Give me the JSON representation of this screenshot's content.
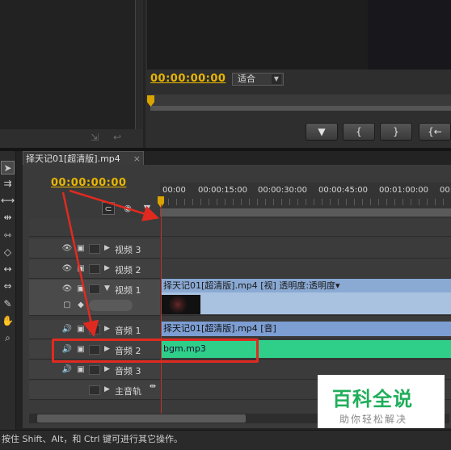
{
  "program_monitor": {
    "timecode": "00:00:00:00",
    "fit_select": "适合",
    "transport_buttons": [
      "▼",
      "{",
      "}",
      "{←"
    ]
  },
  "source_monitor": {
    "controls": [
      "⇲",
      "↩"
    ]
  },
  "timeline": {
    "tab_label": "择天记01[超清版].mp4",
    "tab_close": "×",
    "timecode": "00:00:00:00",
    "ruler_ticks": [
      "00:00",
      "00:00:15:00",
      "00:00:30:00",
      "00:00:45:00",
      "00:01:00:00",
      "00:"
    ],
    "tracks": [
      {
        "name": "视频 3"
      },
      {
        "name": "视频 2"
      },
      {
        "name": "视频 1"
      },
      {
        "name": "音频 1"
      },
      {
        "name": "音频 2"
      },
      {
        "name": "音频 3"
      },
      {
        "name": "主音轨"
      }
    ],
    "video_clip_label": "择天记01[超清版].mp4 [视] 透明度:透明度▾",
    "audio_clip1_label": "择天记01[超清版].mp4 [音]",
    "audio_clip2_label": "bgm.mp3"
  },
  "status_bar": "按住 Shift、Alt，和 Ctrl 键可进行其它操作。",
  "watermark": {
    "title": "百科全说",
    "subtitle": "助你轻松解决"
  },
  "colors": {
    "timecode": "#e8b600",
    "annotation": "#e02a20",
    "audio_clip2": "#2fcf8a",
    "video_clip": "#8aa9d3",
    "watermark_green": "#1fae5a"
  }
}
